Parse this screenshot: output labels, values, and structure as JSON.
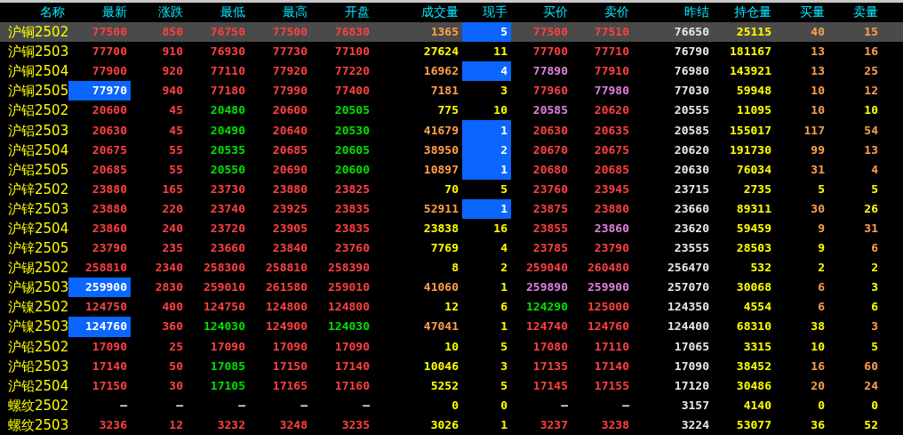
{
  "columns": [
    "名称",
    "最新",
    "涨跌",
    "最低",
    "最高",
    "开盘",
    "成交量",
    "现手",
    "买价",
    "卖价",
    "昨结",
    "持仓量",
    "买量",
    "卖量"
  ],
  "rows": [
    {
      "selected": true,
      "cells": [
        {
          "text": "沪铜2502",
          "color": "#ffff00",
          "highlighted": false
        },
        {
          "text": "77500",
          "color": "#ff4040",
          "highlighted": false
        },
        {
          "text": "850",
          "color": "#ff4040",
          "highlighted": false
        },
        {
          "text": "76750",
          "color": "#ff4040",
          "highlighted": false
        },
        {
          "text": "77500",
          "color": "#ff4040",
          "highlighted": false
        },
        {
          "text": "76830",
          "color": "#ff4040",
          "highlighted": false
        },
        {
          "text": "1365",
          "color": "#ff9f4a",
          "highlighted": false
        },
        {
          "text": "5",
          "color": "#ffffff",
          "highlighted": true
        },
        {
          "text": "77500",
          "color": "#ff4040",
          "highlighted": false
        },
        {
          "text": "77510",
          "color": "#ff4040",
          "highlighted": false
        },
        {
          "text": "76650",
          "color": "#e8e8e8",
          "highlighted": false
        },
        {
          "text": "25115",
          "color": "#ffff00",
          "highlighted": false
        },
        {
          "text": "40",
          "color": "#ff9f4a",
          "highlighted": false
        },
        {
          "text": "15",
          "color": "#ff9f4a",
          "highlighted": false
        }
      ]
    },
    {
      "selected": false,
      "cells": [
        {
          "text": "沪铜2503",
          "color": "#ffff00",
          "highlighted": false
        },
        {
          "text": "77700",
          "color": "#ff4040",
          "highlighted": false
        },
        {
          "text": "910",
          "color": "#ff4040",
          "highlighted": false
        },
        {
          "text": "76930",
          "color": "#ff4040",
          "highlighted": false
        },
        {
          "text": "77730",
          "color": "#ff4040",
          "highlighted": false
        },
        {
          "text": "77100",
          "color": "#ff4040",
          "highlighted": false
        },
        {
          "text": "27624",
          "color": "#ffff00",
          "highlighted": false
        },
        {
          "text": "11",
          "color": "#ffff00",
          "highlighted": false
        },
        {
          "text": "77700",
          "color": "#ff4040",
          "highlighted": false
        },
        {
          "text": "77710",
          "color": "#ff4040",
          "highlighted": false
        },
        {
          "text": "76790",
          "color": "#e8e8e8",
          "highlighted": false
        },
        {
          "text": "181167",
          "color": "#ffff00",
          "highlighted": false
        },
        {
          "text": "13",
          "color": "#ff9f4a",
          "highlighted": false
        },
        {
          "text": "16",
          "color": "#ff9f4a",
          "highlighted": false
        }
      ]
    },
    {
      "selected": false,
      "cells": [
        {
          "text": "沪铜2504",
          "color": "#ffff00",
          "highlighted": false
        },
        {
          "text": "77900",
          "color": "#ff4040",
          "highlighted": false
        },
        {
          "text": "920",
          "color": "#ff4040",
          "highlighted": false
        },
        {
          "text": "77110",
          "color": "#ff4040",
          "highlighted": false
        },
        {
          "text": "77920",
          "color": "#ff4040",
          "highlighted": false
        },
        {
          "text": "77220",
          "color": "#ff4040",
          "highlighted": false
        },
        {
          "text": "16962",
          "color": "#ff9f4a",
          "highlighted": false
        },
        {
          "text": "4",
          "color": "#ffffff",
          "highlighted": true
        },
        {
          "text": "77890",
          "color": "#e080e0",
          "highlighted": false
        },
        {
          "text": "77910",
          "color": "#ff4040",
          "highlighted": false
        },
        {
          "text": "76980",
          "color": "#e8e8e8",
          "highlighted": false
        },
        {
          "text": "143921",
          "color": "#ffff00",
          "highlighted": false
        },
        {
          "text": "13",
          "color": "#ff9f4a",
          "highlighted": false
        },
        {
          "text": "25",
          "color": "#ff9f4a",
          "highlighted": false
        }
      ]
    },
    {
      "selected": false,
      "cells": [
        {
          "text": "沪铜2505",
          "color": "#ffff00",
          "highlighted": false
        },
        {
          "text": "77970",
          "color": "#ffffff",
          "highlighted": true
        },
        {
          "text": "940",
          "color": "#ff4040",
          "highlighted": false
        },
        {
          "text": "77180",
          "color": "#ff4040",
          "highlighted": false
        },
        {
          "text": "77990",
          "color": "#ff4040",
          "highlighted": false
        },
        {
          "text": "77400",
          "color": "#ff4040",
          "highlighted": false
        },
        {
          "text": "7181",
          "color": "#ff9f4a",
          "highlighted": false
        },
        {
          "text": "3",
          "color": "#ffff00",
          "highlighted": false
        },
        {
          "text": "77960",
          "color": "#ff4040",
          "highlighted": false
        },
        {
          "text": "77980",
          "color": "#e080e0",
          "highlighted": false
        },
        {
          "text": "77030",
          "color": "#e8e8e8",
          "highlighted": false
        },
        {
          "text": "59948",
          "color": "#ffff00",
          "highlighted": false
        },
        {
          "text": "10",
          "color": "#ff9f4a",
          "highlighted": false
        },
        {
          "text": "12",
          "color": "#ff9f4a",
          "highlighted": false
        }
      ]
    },
    {
      "selected": false,
      "cells": [
        {
          "text": "沪铝2502",
          "color": "#ffff00",
          "highlighted": false
        },
        {
          "text": "20600",
          "color": "#ff4040",
          "highlighted": false
        },
        {
          "text": "45",
          "color": "#ff4040",
          "highlighted": false
        },
        {
          "text": "20480",
          "color": "#00e000",
          "highlighted": false
        },
        {
          "text": "20600",
          "color": "#ff4040",
          "highlighted": false
        },
        {
          "text": "20505",
          "color": "#00e000",
          "highlighted": false
        },
        {
          "text": "775",
          "color": "#ffff00",
          "highlighted": false
        },
        {
          "text": "10",
          "color": "#ffff00",
          "highlighted": false
        },
        {
          "text": "20585",
          "color": "#e080e0",
          "highlighted": false
        },
        {
          "text": "20620",
          "color": "#ff4040",
          "highlighted": false
        },
        {
          "text": "20555",
          "color": "#e8e8e8",
          "highlighted": false
        },
        {
          "text": "11095",
          "color": "#ffff00",
          "highlighted": false
        },
        {
          "text": "10",
          "color": "#ff9f4a",
          "highlighted": false
        },
        {
          "text": "10",
          "color": "#ffff00",
          "highlighted": false
        }
      ]
    },
    {
      "selected": false,
      "cells": [
        {
          "text": "沪铝2503",
          "color": "#ffff00",
          "highlighted": false
        },
        {
          "text": "20630",
          "color": "#ff4040",
          "highlighted": false
        },
        {
          "text": "45",
          "color": "#ff4040",
          "highlighted": false
        },
        {
          "text": "20490",
          "color": "#00e000",
          "highlighted": false
        },
        {
          "text": "20640",
          "color": "#ff4040",
          "highlighted": false
        },
        {
          "text": "20530",
          "color": "#00e000",
          "highlighted": false
        },
        {
          "text": "41679",
          "color": "#ff9f4a",
          "highlighted": false
        },
        {
          "text": "1",
          "color": "#ffffff",
          "highlighted": true
        },
        {
          "text": "20630",
          "color": "#ff4040",
          "highlighted": false
        },
        {
          "text": "20635",
          "color": "#ff4040",
          "highlighted": false
        },
        {
          "text": "20585",
          "color": "#e8e8e8",
          "highlighted": false
        },
        {
          "text": "155017",
          "color": "#ffff00",
          "highlighted": false
        },
        {
          "text": "117",
          "color": "#ff9f4a",
          "highlighted": false
        },
        {
          "text": "54",
          "color": "#ff9f4a",
          "highlighted": false
        }
      ]
    },
    {
      "selected": false,
      "cells": [
        {
          "text": "沪铝2504",
          "color": "#ffff00",
          "highlighted": false
        },
        {
          "text": "20675",
          "color": "#ff4040",
          "highlighted": false
        },
        {
          "text": "55",
          "color": "#ff4040",
          "highlighted": false
        },
        {
          "text": "20535",
          "color": "#00e000",
          "highlighted": false
        },
        {
          "text": "20685",
          "color": "#ff4040",
          "highlighted": false
        },
        {
          "text": "20605",
          "color": "#00e000",
          "highlighted": false
        },
        {
          "text": "38950",
          "color": "#ff9f4a",
          "highlighted": false
        },
        {
          "text": "2",
          "color": "#ffffff",
          "highlighted": true
        },
        {
          "text": "20670",
          "color": "#ff4040",
          "highlighted": false
        },
        {
          "text": "20675",
          "color": "#ff4040",
          "highlighted": false
        },
        {
          "text": "20620",
          "color": "#e8e8e8",
          "highlighted": false
        },
        {
          "text": "191730",
          "color": "#ffff00",
          "highlighted": false
        },
        {
          "text": "99",
          "color": "#ff9f4a",
          "highlighted": false
        },
        {
          "text": "13",
          "color": "#ff9f4a",
          "highlighted": false
        }
      ]
    },
    {
      "selected": false,
      "cells": [
        {
          "text": "沪铝2505",
          "color": "#ffff00",
          "highlighted": false
        },
        {
          "text": "20685",
          "color": "#ff4040",
          "highlighted": false
        },
        {
          "text": "55",
          "color": "#ff4040",
          "highlighted": false
        },
        {
          "text": "20550",
          "color": "#00e000",
          "highlighted": false
        },
        {
          "text": "20690",
          "color": "#ff4040",
          "highlighted": false
        },
        {
          "text": "20600",
          "color": "#00e000",
          "highlighted": false
        },
        {
          "text": "10897",
          "color": "#ff9f4a",
          "highlighted": false
        },
        {
          "text": "1",
          "color": "#ffffff",
          "highlighted": true
        },
        {
          "text": "20680",
          "color": "#ff4040",
          "highlighted": false
        },
        {
          "text": "20685",
          "color": "#ff4040",
          "highlighted": false
        },
        {
          "text": "20630",
          "color": "#e8e8e8",
          "highlighted": false
        },
        {
          "text": "76034",
          "color": "#ffff00",
          "highlighted": false
        },
        {
          "text": "31",
          "color": "#ff9f4a",
          "highlighted": false
        },
        {
          "text": "4",
          "color": "#ff9f4a",
          "highlighted": false
        }
      ]
    },
    {
      "selected": false,
      "cells": [
        {
          "text": "沪锌2502",
          "color": "#ffff00",
          "highlighted": false
        },
        {
          "text": "23880",
          "color": "#ff4040",
          "highlighted": false
        },
        {
          "text": "165",
          "color": "#ff4040",
          "highlighted": false
        },
        {
          "text": "23730",
          "color": "#ff4040",
          "highlighted": false
        },
        {
          "text": "23880",
          "color": "#ff4040",
          "highlighted": false
        },
        {
          "text": "23825",
          "color": "#ff4040",
          "highlighted": false
        },
        {
          "text": "70",
          "color": "#ffff00",
          "highlighted": false
        },
        {
          "text": "5",
          "color": "#ffff00",
          "highlighted": false
        },
        {
          "text": "23760",
          "color": "#ff4040",
          "highlighted": false
        },
        {
          "text": "23945",
          "color": "#ff4040",
          "highlighted": false
        },
        {
          "text": "23715",
          "color": "#e8e8e8",
          "highlighted": false
        },
        {
          "text": "2735",
          "color": "#ffff00",
          "highlighted": false
        },
        {
          "text": "5",
          "color": "#ffff00",
          "highlighted": false
        },
        {
          "text": "5",
          "color": "#ffff00",
          "highlighted": false
        }
      ]
    },
    {
      "selected": false,
      "cells": [
        {
          "text": "沪锌2503",
          "color": "#ffff00",
          "highlighted": false
        },
        {
          "text": "23880",
          "color": "#ff4040",
          "highlighted": false
        },
        {
          "text": "220",
          "color": "#ff4040",
          "highlighted": false
        },
        {
          "text": "23740",
          "color": "#ff4040",
          "highlighted": false
        },
        {
          "text": "23925",
          "color": "#ff4040",
          "highlighted": false
        },
        {
          "text": "23835",
          "color": "#ff4040",
          "highlighted": false
        },
        {
          "text": "52911",
          "color": "#ff9f4a",
          "highlighted": false
        },
        {
          "text": "1",
          "color": "#ffffff",
          "highlighted": true
        },
        {
          "text": "23875",
          "color": "#ff4040",
          "highlighted": false
        },
        {
          "text": "23880",
          "color": "#ff4040",
          "highlighted": false
        },
        {
          "text": "23660",
          "color": "#e8e8e8",
          "highlighted": false
        },
        {
          "text": "89311",
          "color": "#ffff00",
          "highlighted": false
        },
        {
          "text": "30",
          "color": "#ff9f4a",
          "highlighted": false
        },
        {
          "text": "26",
          "color": "#ffff00",
          "highlighted": false
        }
      ]
    },
    {
      "selected": false,
      "cells": [
        {
          "text": "沪锌2504",
          "color": "#ffff00",
          "highlighted": false
        },
        {
          "text": "23860",
          "color": "#ff4040",
          "highlighted": false
        },
        {
          "text": "240",
          "color": "#ff4040",
          "highlighted": false
        },
        {
          "text": "23720",
          "color": "#ff4040",
          "highlighted": false
        },
        {
          "text": "23905",
          "color": "#ff4040",
          "highlighted": false
        },
        {
          "text": "23835",
          "color": "#ff4040",
          "highlighted": false
        },
        {
          "text": "23838",
          "color": "#ffff00",
          "highlighted": false
        },
        {
          "text": "16",
          "color": "#ffff00",
          "highlighted": false
        },
        {
          "text": "23855",
          "color": "#ff4040",
          "highlighted": false
        },
        {
          "text": "23860",
          "color": "#e080e0",
          "highlighted": false
        },
        {
          "text": "23620",
          "color": "#e8e8e8",
          "highlighted": false
        },
        {
          "text": "59459",
          "color": "#ffff00",
          "highlighted": false
        },
        {
          "text": "9",
          "color": "#ff9f4a",
          "highlighted": false
        },
        {
          "text": "31",
          "color": "#ff9f4a",
          "highlighted": false
        }
      ]
    },
    {
      "selected": false,
      "cells": [
        {
          "text": "沪锌2505",
          "color": "#ffff00",
          "highlighted": false
        },
        {
          "text": "23790",
          "color": "#ff4040",
          "highlighted": false
        },
        {
          "text": "235",
          "color": "#ff4040",
          "highlighted": false
        },
        {
          "text": "23660",
          "color": "#ff4040",
          "highlighted": false
        },
        {
          "text": "23840",
          "color": "#ff4040",
          "highlighted": false
        },
        {
          "text": "23760",
          "color": "#ff4040",
          "highlighted": false
        },
        {
          "text": "7769",
          "color": "#ffff00",
          "highlighted": false
        },
        {
          "text": "4",
          "color": "#ffff00",
          "highlighted": false
        },
        {
          "text": "23785",
          "color": "#ff4040",
          "highlighted": false
        },
        {
          "text": "23790",
          "color": "#ff4040",
          "highlighted": false
        },
        {
          "text": "23555",
          "color": "#e8e8e8",
          "highlighted": false
        },
        {
          "text": "28503",
          "color": "#ffff00",
          "highlighted": false
        },
        {
          "text": "9",
          "color": "#ffff00",
          "highlighted": false
        },
        {
          "text": "6",
          "color": "#ff9f4a",
          "highlighted": false
        }
      ]
    },
    {
      "selected": false,
      "cells": [
        {
          "text": "沪锡2502",
          "color": "#ffff00",
          "highlighted": false
        },
        {
          "text": "258810",
          "color": "#ff4040",
          "highlighted": false
        },
        {
          "text": "2340",
          "color": "#ff4040",
          "highlighted": false
        },
        {
          "text": "258300",
          "color": "#ff4040",
          "highlighted": false
        },
        {
          "text": "258810",
          "color": "#ff4040",
          "highlighted": false
        },
        {
          "text": "258390",
          "color": "#ff4040",
          "highlighted": false
        },
        {
          "text": "8",
          "color": "#ffff00",
          "highlighted": false
        },
        {
          "text": "2",
          "color": "#ffff00",
          "highlighted": false
        },
        {
          "text": "259040",
          "color": "#ff4040",
          "highlighted": false
        },
        {
          "text": "260480",
          "color": "#ff4040",
          "highlighted": false
        },
        {
          "text": "256470",
          "color": "#e8e8e8",
          "highlighted": false
        },
        {
          "text": "532",
          "color": "#ffff00",
          "highlighted": false
        },
        {
          "text": "2",
          "color": "#ffff00",
          "highlighted": false
        },
        {
          "text": "2",
          "color": "#ffff00",
          "highlighted": false
        }
      ]
    },
    {
      "selected": false,
      "cells": [
        {
          "text": "沪锡2503",
          "color": "#ffff00",
          "highlighted": false
        },
        {
          "text": "259900",
          "color": "#ffffff",
          "highlighted": true
        },
        {
          "text": "2830",
          "color": "#ff4040",
          "highlighted": false
        },
        {
          "text": "259010",
          "color": "#ff4040",
          "highlighted": false
        },
        {
          "text": "261580",
          "color": "#ff4040",
          "highlighted": false
        },
        {
          "text": "259010",
          "color": "#ff4040",
          "highlighted": false
        },
        {
          "text": "41060",
          "color": "#ff9f4a",
          "highlighted": false
        },
        {
          "text": "1",
          "color": "#ffff00",
          "highlighted": false
        },
        {
          "text": "259890",
          "color": "#e080e0",
          "highlighted": false
        },
        {
          "text": "259900",
          "color": "#e080e0",
          "highlighted": false
        },
        {
          "text": "257070",
          "color": "#e8e8e8",
          "highlighted": false
        },
        {
          "text": "30068",
          "color": "#ffff00",
          "highlighted": false
        },
        {
          "text": "6",
          "color": "#ff9f4a",
          "highlighted": false
        },
        {
          "text": "3",
          "color": "#ffff00",
          "highlighted": false
        }
      ]
    },
    {
      "selected": false,
      "cells": [
        {
          "text": "沪镍2502",
          "color": "#ffff00",
          "highlighted": false
        },
        {
          "text": "124750",
          "color": "#ff4040",
          "highlighted": false
        },
        {
          "text": "400",
          "color": "#ff4040",
          "highlighted": false
        },
        {
          "text": "124750",
          "color": "#ff4040",
          "highlighted": false
        },
        {
          "text": "124800",
          "color": "#ff4040",
          "highlighted": false
        },
        {
          "text": "124800",
          "color": "#ff4040",
          "highlighted": false
        },
        {
          "text": "12",
          "color": "#ffff00",
          "highlighted": false
        },
        {
          "text": "6",
          "color": "#ffff00",
          "highlighted": false
        },
        {
          "text": "124290",
          "color": "#00e000",
          "highlighted": false
        },
        {
          "text": "125000",
          "color": "#ff4040",
          "highlighted": false
        },
        {
          "text": "124350",
          "color": "#e8e8e8",
          "highlighted": false
        },
        {
          "text": "4554",
          "color": "#ffff00",
          "highlighted": false
        },
        {
          "text": "6",
          "color": "#ff9f4a",
          "highlighted": false
        },
        {
          "text": "6",
          "color": "#ffff00",
          "highlighted": false
        }
      ]
    },
    {
      "selected": false,
      "cells": [
        {
          "text": "沪镍2503",
          "color": "#ffff00",
          "highlighted": false
        },
        {
          "text": "124760",
          "color": "#ffffff",
          "highlighted": true
        },
        {
          "text": "360",
          "color": "#ff4040",
          "highlighted": false
        },
        {
          "text": "124030",
          "color": "#00e000",
          "highlighted": false
        },
        {
          "text": "124900",
          "color": "#ff4040",
          "highlighted": false
        },
        {
          "text": "124030",
          "color": "#00e000",
          "highlighted": false
        },
        {
          "text": "47041",
          "color": "#ff9f4a",
          "highlighted": false
        },
        {
          "text": "1",
          "color": "#ffff00",
          "highlighted": false
        },
        {
          "text": "124740",
          "color": "#ff4040",
          "highlighted": false
        },
        {
          "text": "124760",
          "color": "#ff4040",
          "highlighted": false
        },
        {
          "text": "124400",
          "color": "#e8e8e8",
          "highlighted": false
        },
        {
          "text": "68310",
          "color": "#ffff00",
          "highlighted": false
        },
        {
          "text": "38",
          "color": "#ffff00",
          "highlighted": false
        },
        {
          "text": "3",
          "color": "#ff9f4a",
          "highlighted": false
        }
      ]
    },
    {
      "selected": false,
      "cells": [
        {
          "text": "沪铅2502",
          "color": "#ffff00",
          "highlighted": false
        },
        {
          "text": "17090",
          "color": "#ff4040",
          "highlighted": false
        },
        {
          "text": "25",
          "color": "#ff4040",
          "highlighted": false
        },
        {
          "text": "17090",
          "color": "#ff4040",
          "highlighted": false
        },
        {
          "text": "17090",
          "color": "#ff4040",
          "highlighted": false
        },
        {
          "text": "17090",
          "color": "#ff4040",
          "highlighted": false
        },
        {
          "text": "10",
          "color": "#ffff00",
          "highlighted": false
        },
        {
          "text": "5",
          "color": "#ffff00",
          "highlighted": false
        },
        {
          "text": "17080",
          "color": "#ff4040",
          "highlighted": false
        },
        {
          "text": "17110",
          "color": "#ff4040",
          "highlighted": false
        },
        {
          "text": "17065",
          "color": "#e8e8e8",
          "highlighted": false
        },
        {
          "text": "3315",
          "color": "#ffff00",
          "highlighted": false
        },
        {
          "text": "10",
          "color": "#ffff00",
          "highlighted": false
        },
        {
          "text": "5",
          "color": "#ffff00",
          "highlighted": false
        }
      ]
    },
    {
      "selected": false,
      "cells": [
        {
          "text": "沪铅2503",
          "color": "#ffff00",
          "highlighted": false
        },
        {
          "text": "17140",
          "color": "#ff4040",
          "highlighted": false
        },
        {
          "text": "50",
          "color": "#ff4040",
          "highlighted": false
        },
        {
          "text": "17085",
          "color": "#00e000",
          "highlighted": false
        },
        {
          "text": "17150",
          "color": "#ff4040",
          "highlighted": false
        },
        {
          "text": "17140",
          "color": "#ff4040",
          "highlighted": false
        },
        {
          "text": "10046",
          "color": "#ffff00",
          "highlighted": false
        },
        {
          "text": "3",
          "color": "#ffff00",
          "highlighted": false
        },
        {
          "text": "17135",
          "color": "#ff4040",
          "highlighted": false
        },
        {
          "text": "17140",
          "color": "#ff4040",
          "highlighted": false
        },
        {
          "text": "17090",
          "color": "#e8e8e8",
          "highlighted": false
        },
        {
          "text": "38452",
          "color": "#ffff00",
          "highlighted": false
        },
        {
          "text": "16",
          "color": "#ff9f4a",
          "highlighted": false
        },
        {
          "text": "60",
          "color": "#ff9f4a",
          "highlighted": false
        }
      ]
    },
    {
      "selected": false,
      "cells": [
        {
          "text": "沪铅2504",
          "color": "#ffff00",
          "highlighted": false
        },
        {
          "text": "17150",
          "color": "#ff4040",
          "highlighted": false
        },
        {
          "text": "30",
          "color": "#ff4040",
          "highlighted": false
        },
        {
          "text": "17105",
          "color": "#00e000",
          "highlighted": false
        },
        {
          "text": "17165",
          "color": "#ff4040",
          "highlighted": false
        },
        {
          "text": "17160",
          "color": "#ff4040",
          "highlighted": false
        },
        {
          "text": "5252",
          "color": "#ffff00",
          "highlighted": false
        },
        {
          "text": "5",
          "color": "#ffff00",
          "highlighted": false
        },
        {
          "text": "17145",
          "color": "#ff4040",
          "highlighted": false
        },
        {
          "text": "17155",
          "color": "#ff4040",
          "highlighted": false
        },
        {
          "text": "17120",
          "color": "#e8e8e8",
          "highlighted": false
        },
        {
          "text": "30486",
          "color": "#ffff00",
          "highlighted": false
        },
        {
          "text": "20",
          "color": "#ff9f4a",
          "highlighted": false
        },
        {
          "text": "24",
          "color": "#ff9f4a",
          "highlighted": false
        }
      ]
    },
    {
      "selected": false,
      "cells": [
        {
          "text": "螺纹2502",
          "color": "#ffff00",
          "highlighted": false
        },
        {
          "text": "—",
          "color": "#e8e8e8",
          "highlighted": false
        },
        {
          "text": "—",
          "color": "#e8e8e8",
          "highlighted": false
        },
        {
          "text": "—",
          "color": "#e8e8e8",
          "highlighted": false
        },
        {
          "text": "—",
          "color": "#e8e8e8",
          "highlighted": false
        },
        {
          "text": "—",
          "color": "#e8e8e8",
          "highlighted": false
        },
        {
          "text": "0",
          "color": "#ffff00",
          "highlighted": false
        },
        {
          "text": "0",
          "color": "#ffff00",
          "highlighted": false
        },
        {
          "text": "—",
          "color": "#e8e8e8",
          "highlighted": false
        },
        {
          "text": "—",
          "color": "#e8e8e8",
          "highlighted": false
        },
        {
          "text": "3157",
          "color": "#e8e8e8",
          "highlighted": false
        },
        {
          "text": "4140",
          "color": "#ffff00",
          "highlighted": false
        },
        {
          "text": "0",
          "color": "#ffff00",
          "highlighted": false
        },
        {
          "text": "0",
          "color": "#ffff00",
          "highlighted": false
        }
      ]
    },
    {
      "selected": false,
      "cells": [
        {
          "text": "螺纹2503",
          "color": "#ffff00",
          "highlighted": false
        },
        {
          "text": "3236",
          "color": "#ff4040",
          "highlighted": false
        },
        {
          "text": "12",
          "color": "#ff4040",
          "highlighted": false
        },
        {
          "text": "3232",
          "color": "#ff4040",
          "highlighted": false
        },
        {
          "text": "3248",
          "color": "#ff4040",
          "highlighted": false
        },
        {
          "text": "3235",
          "color": "#ff4040",
          "highlighted": false
        },
        {
          "text": "3026",
          "color": "#ffff00",
          "highlighted": false
        },
        {
          "text": "1",
          "color": "#ffff00",
          "highlighted": false
        },
        {
          "text": "3237",
          "color": "#ff4040",
          "highlighted": false
        },
        {
          "text": "3238",
          "color": "#ff4040",
          "highlighted": false
        },
        {
          "text": "3224",
          "color": "#e8e8e8",
          "highlighted": false
        },
        {
          "text": "53077",
          "color": "#ffff00",
          "highlighted": false
        },
        {
          "text": "36",
          "color": "#ffff00",
          "highlighted": false
        },
        {
          "text": "52",
          "color": "#ffff00",
          "highlighted": false
        }
      ]
    }
  ]
}
